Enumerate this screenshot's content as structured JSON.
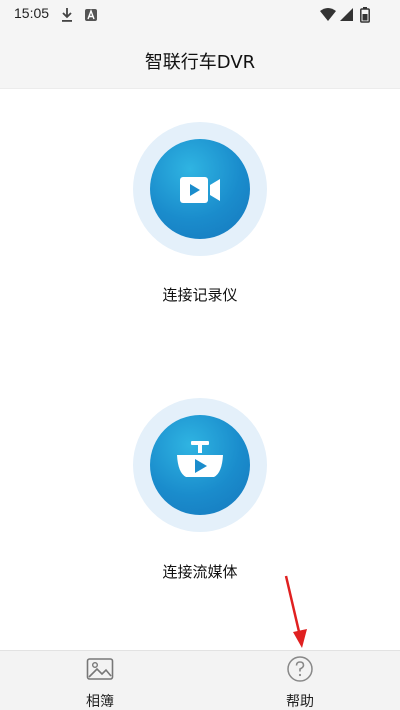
{
  "status_bar": {
    "time": "15:05",
    "icons": [
      "download-icon",
      "a-badge-icon",
      "wifi-icon",
      "signal-icon",
      "battery-icon"
    ]
  },
  "header": {
    "title": "智联行车DVR"
  },
  "main": {
    "connect_recorder": {
      "label": "连接记录仪",
      "icon": "video-camera-icon"
    },
    "connect_stream": {
      "label": "连接流媒体",
      "icon": "rearview-mirror-icon"
    }
  },
  "bottom_nav": {
    "items": [
      {
        "label": "相簿",
        "icon": "album-icon"
      },
      {
        "label": "帮助",
        "icon": "help-icon"
      }
    ]
  },
  "colors": {
    "accent": "#1a8ccc",
    "ring": "#e4f0fa",
    "annotation_arrow": "#e02020"
  }
}
